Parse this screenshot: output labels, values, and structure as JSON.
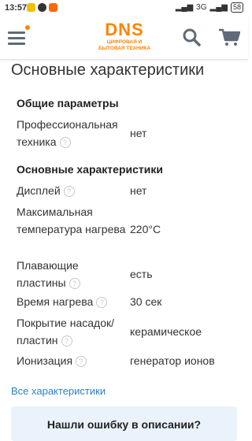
{
  "status_bar": {
    "time": "13:57",
    "network": "3G",
    "battery": "58"
  },
  "header": {
    "logo_main": "DNS",
    "logo_line1": "ЦИФРОВАЯ И",
    "logo_line2": "БЫТОВАЯ ТЕХНИКА",
    "accent_color": "#fc8507"
  },
  "page": {
    "title": "Основные характеристики"
  },
  "groups": [
    {
      "title": "Общие параметры",
      "rows": [
        {
          "name": "Профессиональная техника",
          "value": "нет"
        }
      ]
    },
    {
      "title": "Основные характеристики",
      "rows": [
        {
          "name": "Дисплей",
          "value": "нет"
        },
        {
          "name": "Максимальная температура нагрева",
          "value": "220°C"
        },
        {
          "name": "Плавающие пластины",
          "value": "есть"
        },
        {
          "name": "Время нагрева",
          "value": "30 сек"
        },
        {
          "name": "Покрытие насадок/пластин",
          "value": "керамическое"
        },
        {
          "name": "Ионизация",
          "value": "генератор ионов"
        }
      ]
    }
  ],
  "help_glyph": "?",
  "all_specs_link": "Все характеристики",
  "error_box_text": "Нашли ошибку в описании?"
}
